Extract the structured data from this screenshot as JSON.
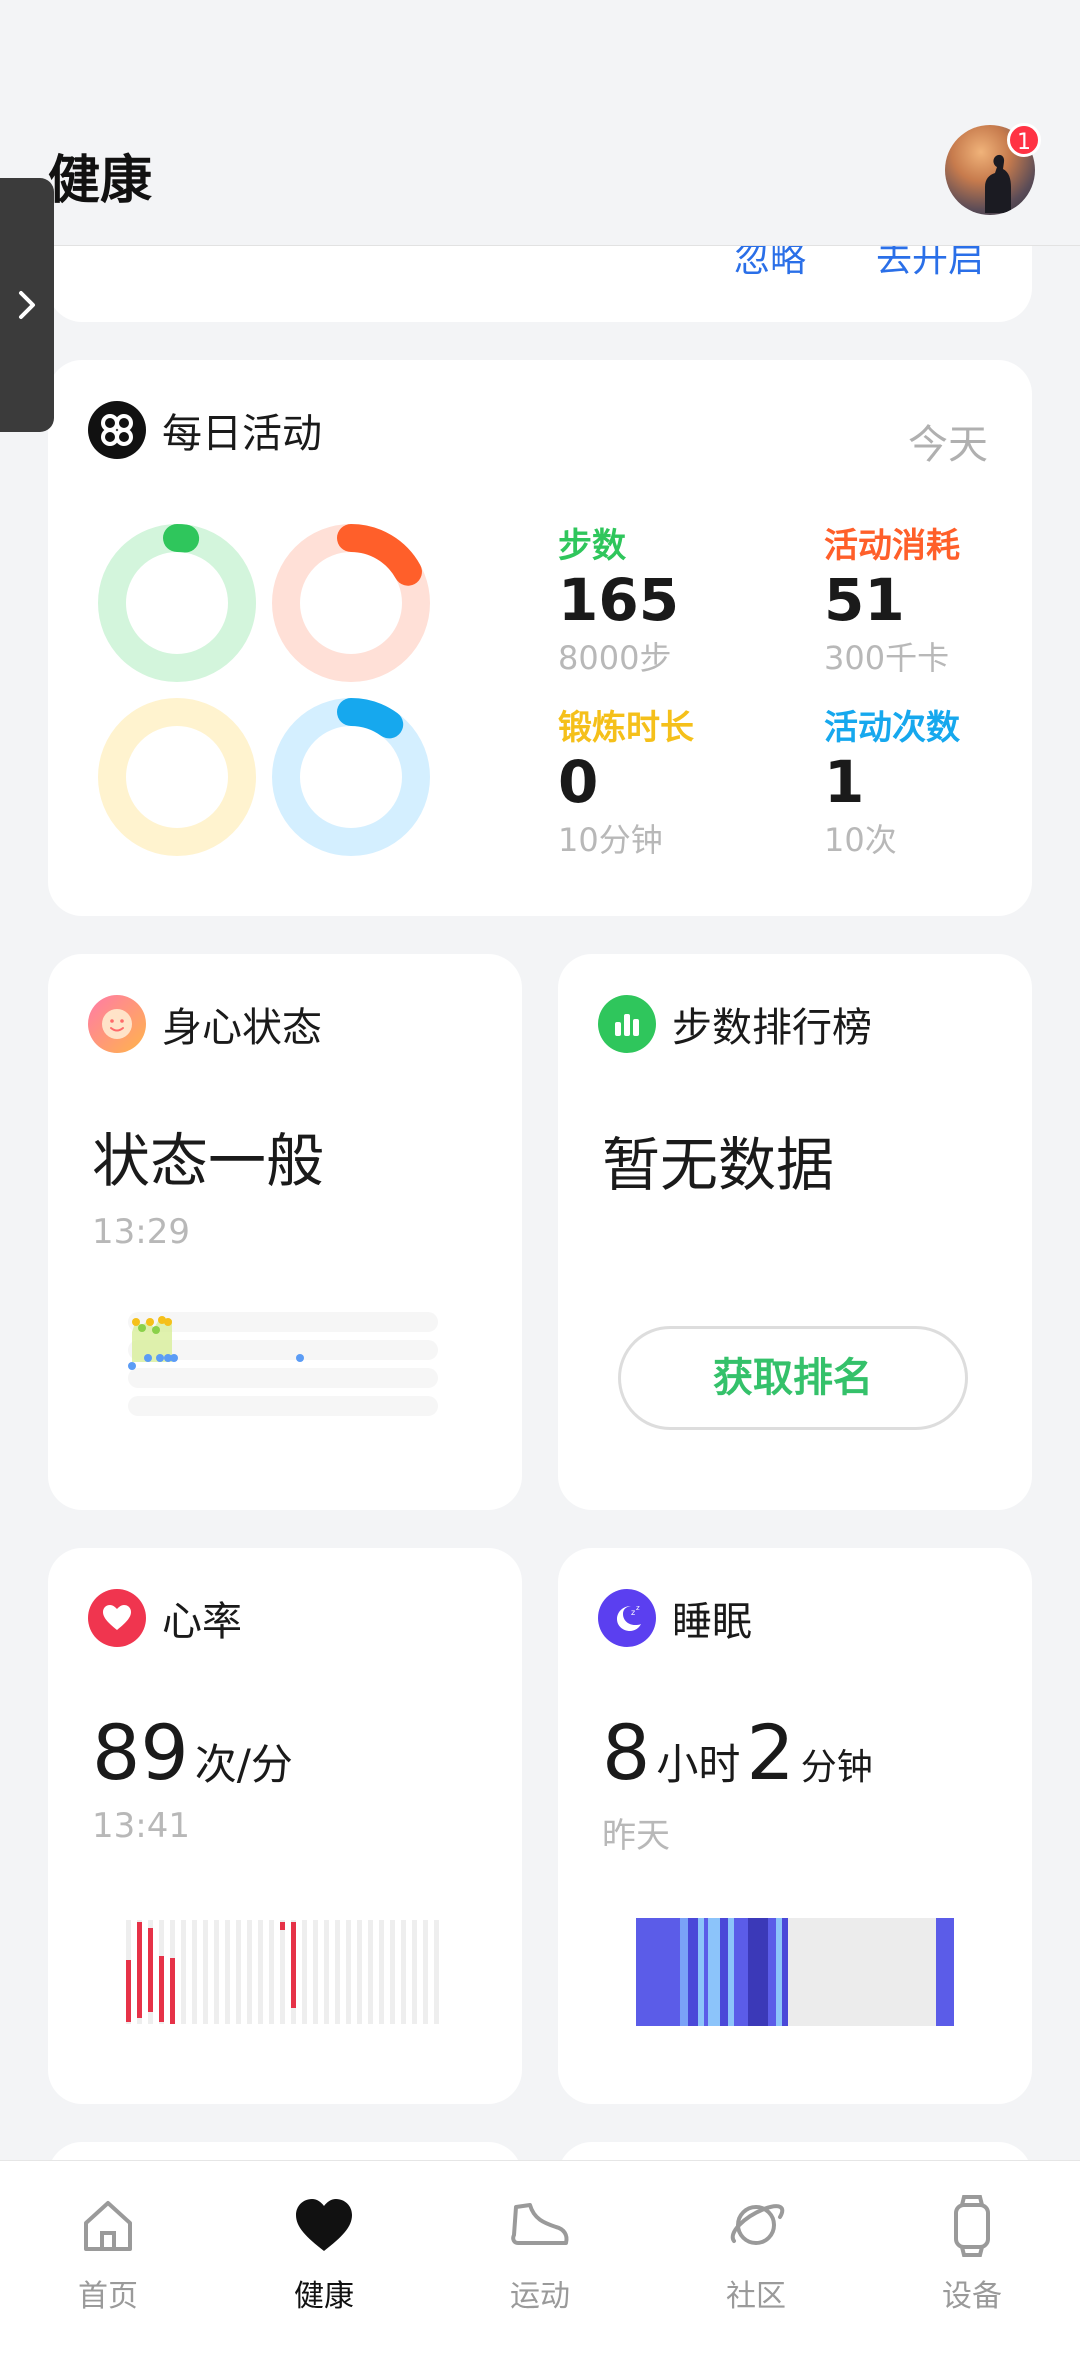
{
  "header": {
    "title": "健康",
    "notification_count": "1"
  },
  "top_card": {
    "ignore_label": "忽略",
    "enable_label": "去开启"
  },
  "daily_activity": {
    "title": "每日活动",
    "date_label": "今天",
    "metrics": [
      {
        "label": "步数",
        "value": "165",
        "goal": "8000步",
        "color": "#2fc65c",
        "progress": 0.02
      },
      {
        "label": "活动消耗",
        "value": "51",
        "goal": "300千卡",
        "color": "#ff5f2a",
        "progress": 0.17
      },
      {
        "label": "锻炼时长",
        "value": "0",
        "goal": "10分钟",
        "color": "#f5c01a",
        "progress": 0.0
      },
      {
        "label": "活动次数",
        "value": "1",
        "goal": "10次",
        "color": "#16a8ee",
        "progress": 0.1
      }
    ]
  },
  "mind_state": {
    "title": "身心状态",
    "status": "状态一般",
    "time": "13:29"
  },
  "step_rank": {
    "title": "步数排行榜",
    "status": "暂无数据",
    "button_label": "获取排名"
  },
  "heart_rate": {
    "title": "心率",
    "value": "89",
    "unit": "次/分",
    "time": "13:41"
  },
  "sleep": {
    "title": "睡眠",
    "hours": "8",
    "hours_unit": "小时",
    "minutes": "2",
    "minutes_unit": "分钟",
    "day": "昨天"
  },
  "nav": {
    "items": [
      {
        "label": "首页",
        "icon": "home-icon"
      },
      {
        "label": "健康",
        "icon": "heart-icon"
      },
      {
        "label": "运动",
        "icon": "shoe-icon"
      },
      {
        "label": "社区",
        "icon": "planet-icon"
      },
      {
        "label": "设备",
        "icon": "watch-icon"
      }
    ],
    "active_index": 1
  }
}
